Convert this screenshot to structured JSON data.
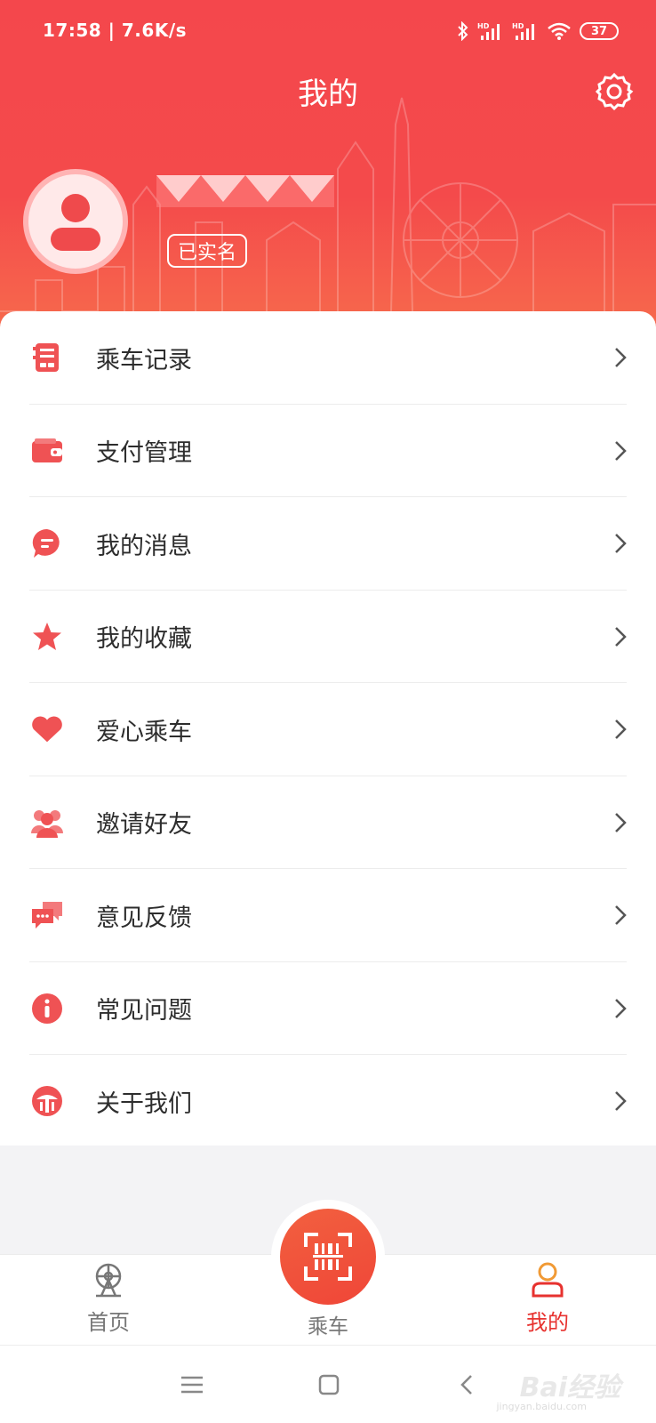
{
  "status_bar": {
    "time_speed": "17:58 | 7.6K/s",
    "battery": "37",
    "icons": [
      "bluetooth-icon",
      "hd-signal-icon",
      "hd-signal-icon",
      "wifi-icon",
      "battery-icon"
    ]
  },
  "header": {
    "title": "我的",
    "verified_badge": "已实名",
    "settings_icon": "gear-icon",
    "avatar_icon": "person-icon"
  },
  "menu": {
    "items": [
      {
        "label": "乘车记录",
        "icon": "ride-record-icon"
      },
      {
        "label": "支付管理",
        "icon": "wallet-icon"
      },
      {
        "label": "我的消息",
        "icon": "message-icon"
      },
      {
        "label": "我的收藏",
        "icon": "star-icon"
      },
      {
        "label": "爱心乘车",
        "icon": "heart-icon"
      },
      {
        "label": "邀请好友",
        "icon": "friends-icon"
      },
      {
        "label": "意见反馈",
        "icon": "feedback-icon"
      },
      {
        "label": "常见问题",
        "icon": "info-icon"
      },
      {
        "label": "关于我们",
        "icon": "about-icon"
      }
    ]
  },
  "bottom_nav": {
    "home": "首页",
    "ride": "乘车",
    "mine": "我的",
    "active": "mine"
  },
  "watermark": {
    "brand": "Bai经验",
    "site": "jingyan.baidu.com"
  },
  "colors": {
    "header_red": "#f4474c",
    "accent": "#e7322f",
    "icon_red": "#ef5254",
    "scan_orange": "#f2603f"
  }
}
